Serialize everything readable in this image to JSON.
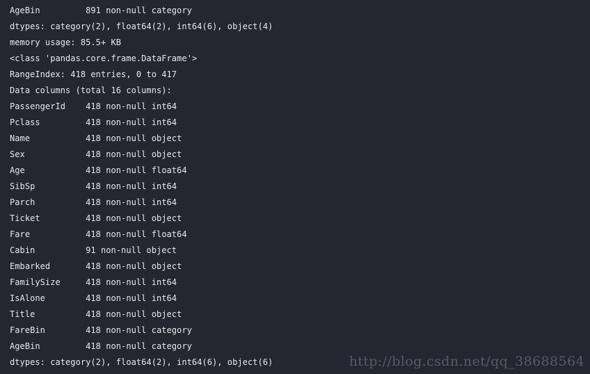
{
  "window": {
    "title": "pandas DataFrame info output",
    "background_color": "#242730",
    "text_color": "#e8e9ea",
    "watermark_color": "#575c68"
  },
  "console": {
    "lines": [
      "AgeBin         891 non-null category",
      "dtypes: category(2), float64(2), int64(6), object(4)",
      "memory usage: 85.5+ KB",
      "<class 'pandas.core.frame.DataFrame'>",
      "RangeIndex: 418 entries, 0 to 417",
      "Data columns (total 16 columns):",
      "PassengerId    418 non-null int64",
      "Pclass         418 non-null int64",
      "Name           418 non-null object",
      "Sex            418 non-null object",
      "Age            418 non-null float64",
      "SibSp          418 non-null int64",
      "Parch          418 non-null int64",
      "Ticket         418 non-null object",
      "Fare           418 non-null float64",
      "Cabin          91 non-null object",
      "Embarked       418 non-null object",
      "FamilySize     418 non-null int64",
      "IsAlone        418 non-null int64",
      "Title          418 non-null object",
      "FareBin        418 non-null category",
      "AgeBin         418 non-null category",
      "dtypes: category(2), float64(2), int64(6), object(6)"
    ],
    "previous_frame_summary": {
      "last_column": "AgeBin",
      "last_column_count": "891 non-null",
      "last_column_dtype": "category",
      "dtypes": "category(2), float64(2), int64(6), object(4)",
      "memory_usage": "85.5+ KB"
    },
    "current_frame_summary": {
      "class": "<class 'pandas.core.frame.DataFrame'>",
      "index": "RangeIndex: 418 entries, 0 to 417",
      "columns_header": "Data columns (total 16 columns):",
      "total_columns": 16,
      "entries": 418,
      "dtypes": "category(2), float64(2), int64(6), object(6)",
      "columns": [
        {
          "name": "PassengerId",
          "count": "418 non-null",
          "dtype": "int64"
        },
        {
          "name": "Pclass",
          "count": "418 non-null",
          "dtype": "int64"
        },
        {
          "name": "Name",
          "count": "418 non-null",
          "dtype": "object"
        },
        {
          "name": "Sex",
          "count": "418 non-null",
          "dtype": "object"
        },
        {
          "name": "Age",
          "count": "418 non-null",
          "dtype": "float64"
        },
        {
          "name": "SibSp",
          "count": "418 non-null",
          "dtype": "int64"
        },
        {
          "name": "Parch",
          "count": "418 non-null",
          "dtype": "int64"
        },
        {
          "name": "Ticket",
          "count": "418 non-null",
          "dtype": "object"
        },
        {
          "name": "Fare",
          "count": "418 non-null",
          "dtype": "float64"
        },
        {
          "name": "Cabin",
          "count": "91 non-null",
          "dtype": "object"
        },
        {
          "name": "Embarked",
          "count": "418 non-null",
          "dtype": "object"
        },
        {
          "name": "FamilySize",
          "count": "418 non-null",
          "dtype": "int64"
        },
        {
          "name": "IsAlone",
          "count": "418 non-null",
          "dtype": "int64"
        },
        {
          "name": "Title",
          "count": "418 non-null",
          "dtype": "object"
        },
        {
          "name": "FareBin",
          "count": "418 non-null",
          "dtype": "category"
        },
        {
          "name": "AgeBin",
          "count": "418 non-null",
          "dtype": "category"
        }
      ]
    }
  },
  "watermark": {
    "text": "http://blog.csdn.net/qq_38688564"
  }
}
